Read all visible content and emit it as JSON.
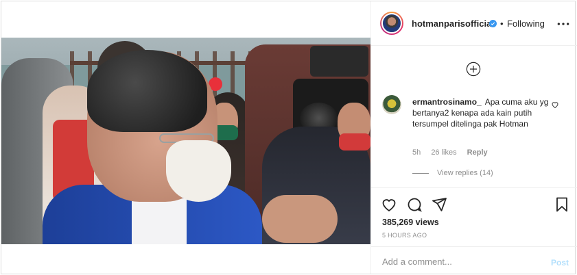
{
  "header": {
    "username": "hotmanparisofficial",
    "separator": "•",
    "follow_status": "Following",
    "more_icon": "ellipsis-icon",
    "verified_icon": "verified-badge-icon",
    "verified_color": "#3897f0"
  },
  "media": {
    "type": "video",
    "sound_icon": "speaker-icon"
  },
  "comments_section": {
    "add_icon": "plus-circle-icon",
    "comments": [
      {
        "username": "ermantrosinamo_",
        "text": "Apa cuma aku yg bertanya2 kenapa ada kain putih tersumpel ditelinga pak Hotman",
        "time": "5h",
        "likes": "26 likes",
        "reply_label": "Reply",
        "view_replies": "View replies (14)"
      }
    ]
  },
  "actions": {
    "like_icon": "heart-icon",
    "comment_icon": "comment-icon",
    "share_icon": "paper-plane-icon",
    "save_icon": "bookmark-icon",
    "views": "385,269 views",
    "timestamp": "5 HOURS AGO"
  },
  "composer": {
    "placeholder": "Add a comment...",
    "post_label": "Post",
    "post_color": "#b2dffc"
  }
}
